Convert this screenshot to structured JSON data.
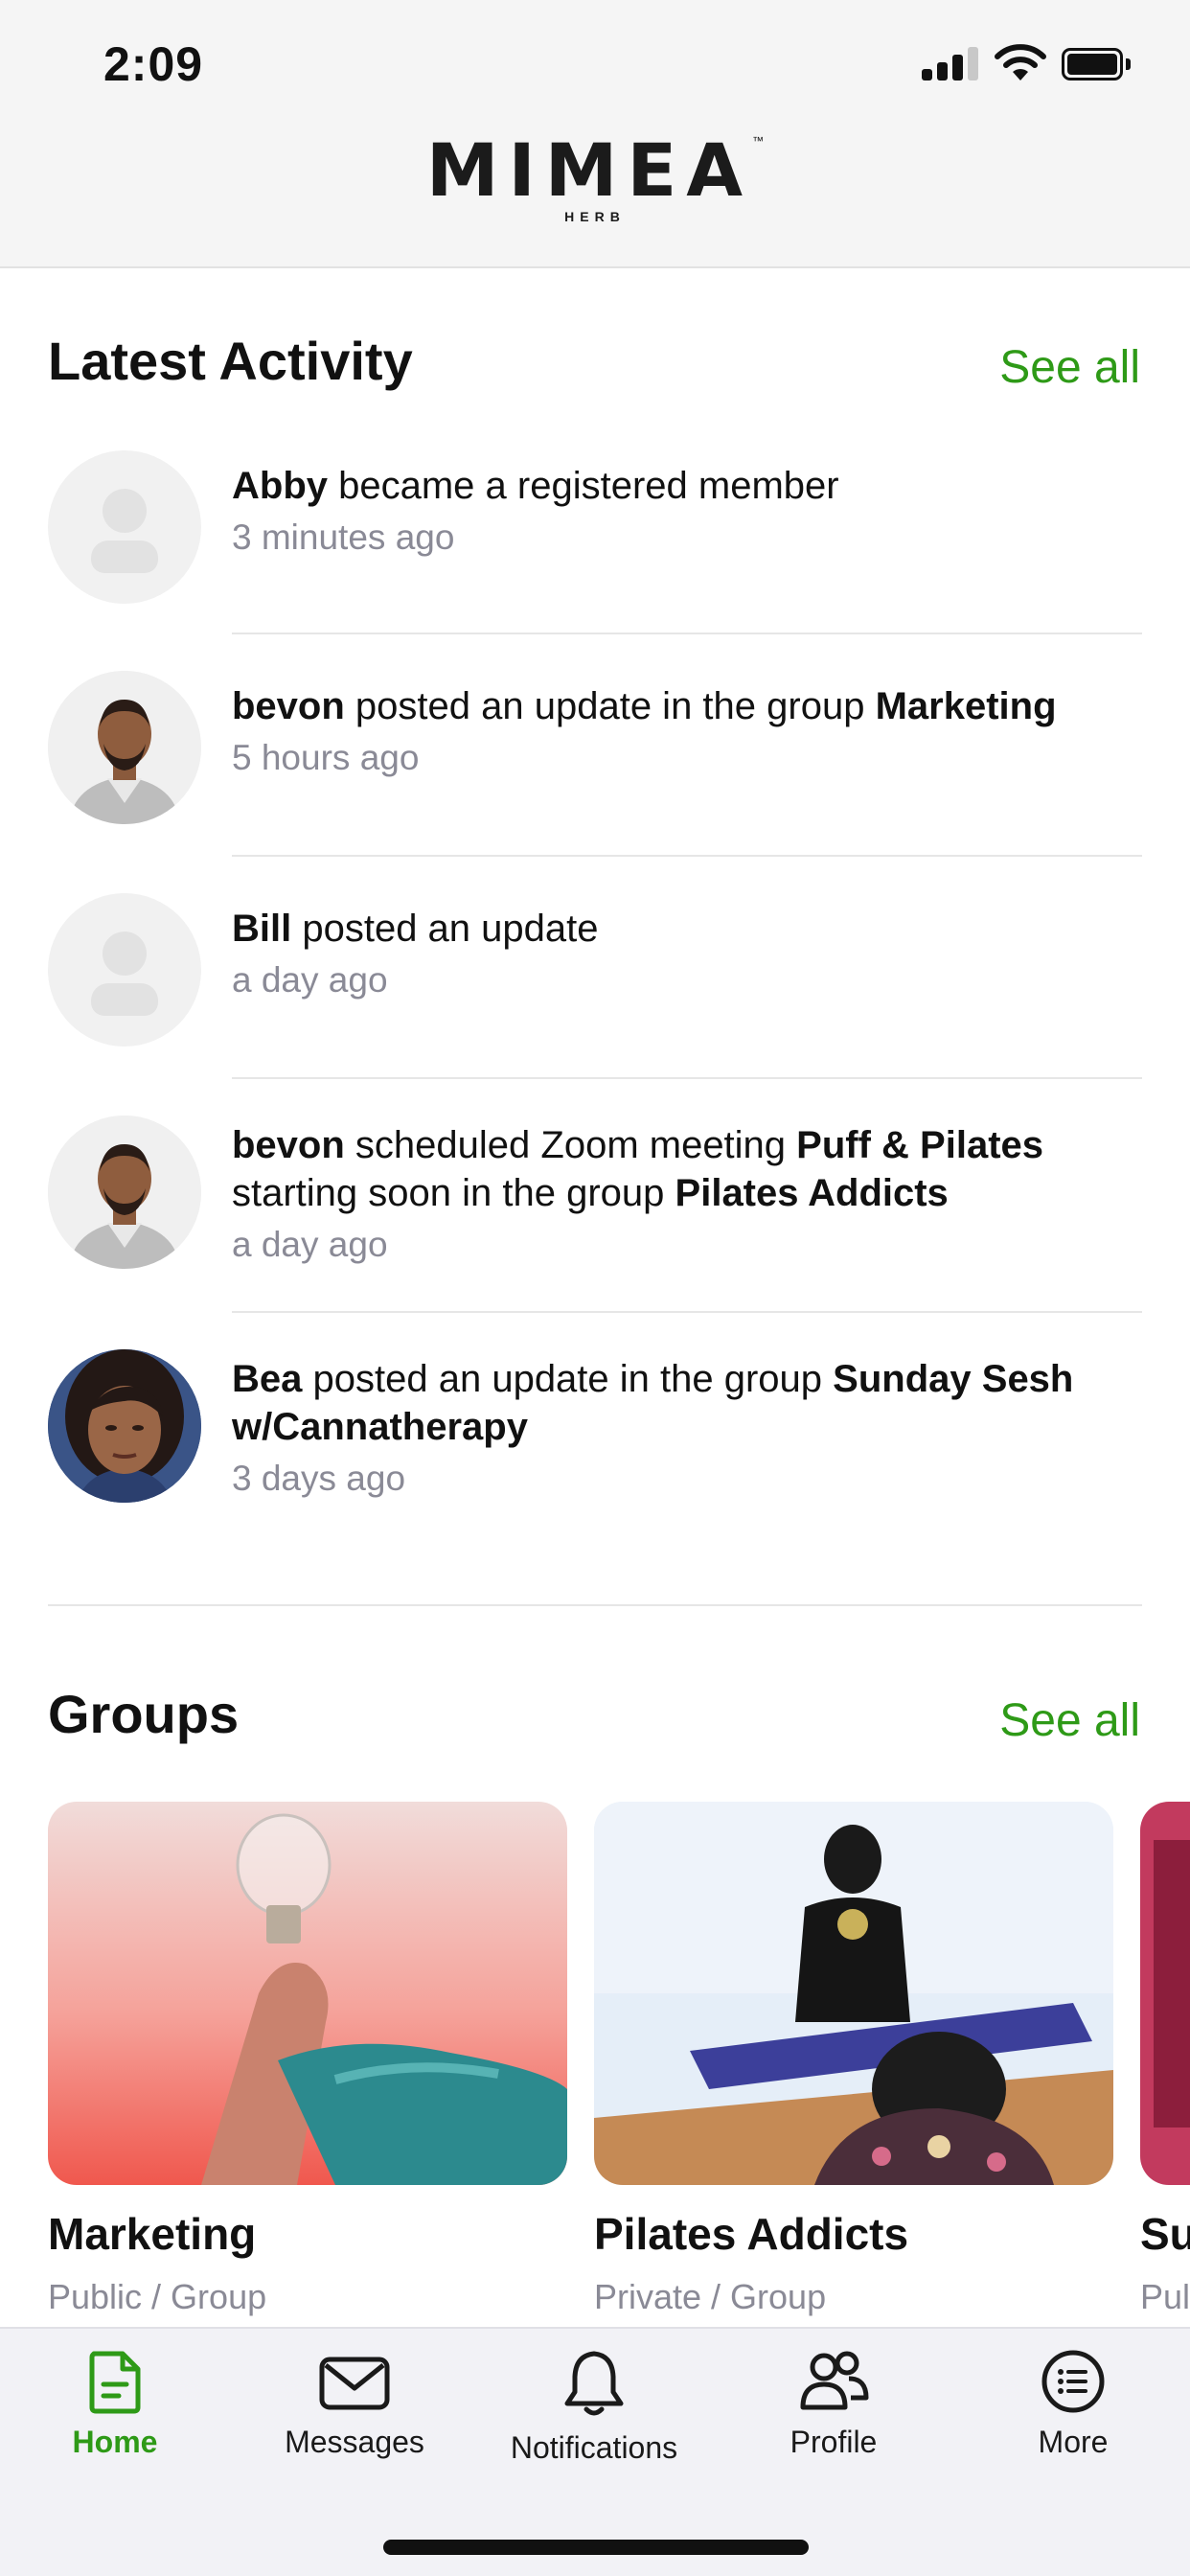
{
  "status_bar": {
    "time": "2:09"
  },
  "header": {
    "logo_word": "MIMEA",
    "logo_sub": "HERB",
    "logo_tm": "™"
  },
  "latest_activity": {
    "title": "Latest Activity",
    "see_all": "See all",
    "items": [
      {
        "actor": "Abby",
        "text": " became a registered member",
        "time": "3 minutes ago",
        "avatar": "placeholder-avatar"
      },
      {
        "actor": "bevon",
        "text": " posted an update in the group ",
        "target": "Marketing",
        "time": "5 hours ago",
        "avatar": "bevon-photo"
      },
      {
        "actor": "Bill",
        "text": " posted an update",
        "time": "a day ago",
        "avatar": "placeholder-avatar"
      },
      {
        "actor": "bevon",
        "text": " scheduled Zoom meeting ",
        "target": "Puff & Pilates",
        "text2": " starting soon in the group ",
        "target2": "Pilates Addicts",
        "time": "a day ago",
        "avatar": "bevon-photo"
      },
      {
        "actor": "Bea",
        "text": " posted an update in the group ",
        "target": "Sunday Sesh w/Cannatherapy",
        "time": "3 days ago",
        "avatar": "bea-photo"
      }
    ]
  },
  "groups": {
    "title": "Groups",
    "see_all": "See all",
    "items": [
      {
        "name": "Marketing",
        "meta": "Public / Group"
      },
      {
        "name": "Pilates Addicts",
        "meta": "Private / Group"
      },
      {
        "name": "Su",
        "meta": "Pul"
      }
    ]
  },
  "tabbar": {
    "items": [
      {
        "label": "Home",
        "icon": "document-icon",
        "active": true
      },
      {
        "label": "Messages",
        "icon": "envelope-icon",
        "active": false
      },
      {
        "label": "Notifications",
        "icon": "bell-icon",
        "active": false
      },
      {
        "label": "Profile",
        "icon": "people-icon",
        "active": false
      },
      {
        "label": "More",
        "icon": "menu-list-icon",
        "active": false
      }
    ]
  },
  "colors": {
    "accent": "#2e9a17",
    "muted": "#8a8a96",
    "tabbar_bg": "#f2f2f6"
  }
}
